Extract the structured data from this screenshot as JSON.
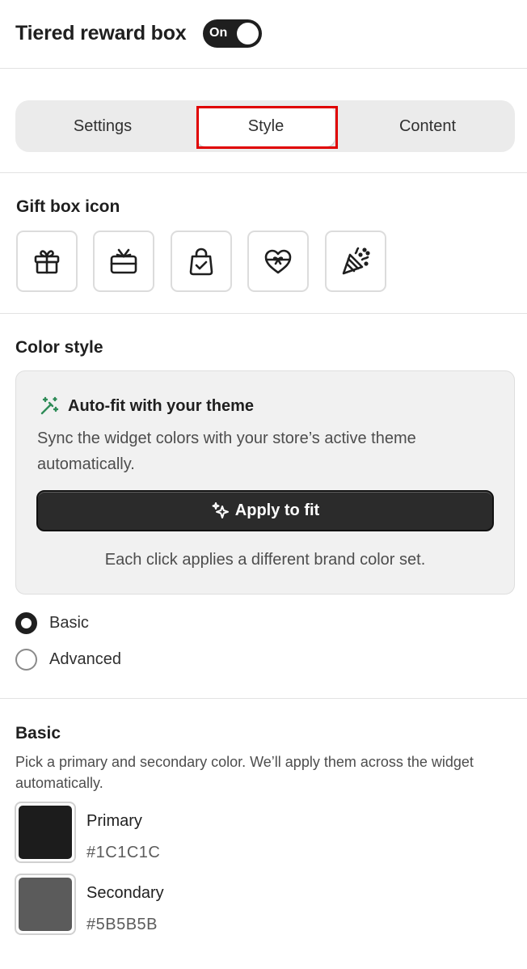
{
  "header": {
    "title": "Tiered reward box",
    "toggle_label": "On"
  },
  "tabs": [
    {
      "label": "Settings",
      "active": false
    },
    {
      "label": "Style",
      "active": true
    },
    {
      "label": "Content",
      "active": false
    }
  ],
  "gift_box": {
    "title": "Gift box icon",
    "icons": [
      "gift-icon",
      "gift-card-icon",
      "shopping-bag-check-icon",
      "heart-ribbon-icon",
      "party-popper-icon"
    ]
  },
  "color_style": {
    "title": "Color style",
    "autofit": {
      "title": "Auto-fit with your theme",
      "description": "Sync the widget colors with your store’s active theme automatically.",
      "button_label": "Apply to fit",
      "note": "Each click applies a different brand color set."
    },
    "options": [
      {
        "label": "Basic",
        "checked": true
      },
      {
        "label": "Advanced",
        "checked": false
      }
    ]
  },
  "basic": {
    "title": "Basic",
    "description": "Pick a primary and secondary color. We’ll apply them across the widget automatically.",
    "colors": [
      {
        "name": "Primary",
        "hex": "#1C1C1C"
      },
      {
        "name": "Secondary",
        "hex": "#5B5B5B"
      }
    ]
  },
  "accent_colors": {
    "dark": "#1f1f1f",
    "highlight_outline": "#e00000",
    "wand_green": "#2e8b57"
  }
}
